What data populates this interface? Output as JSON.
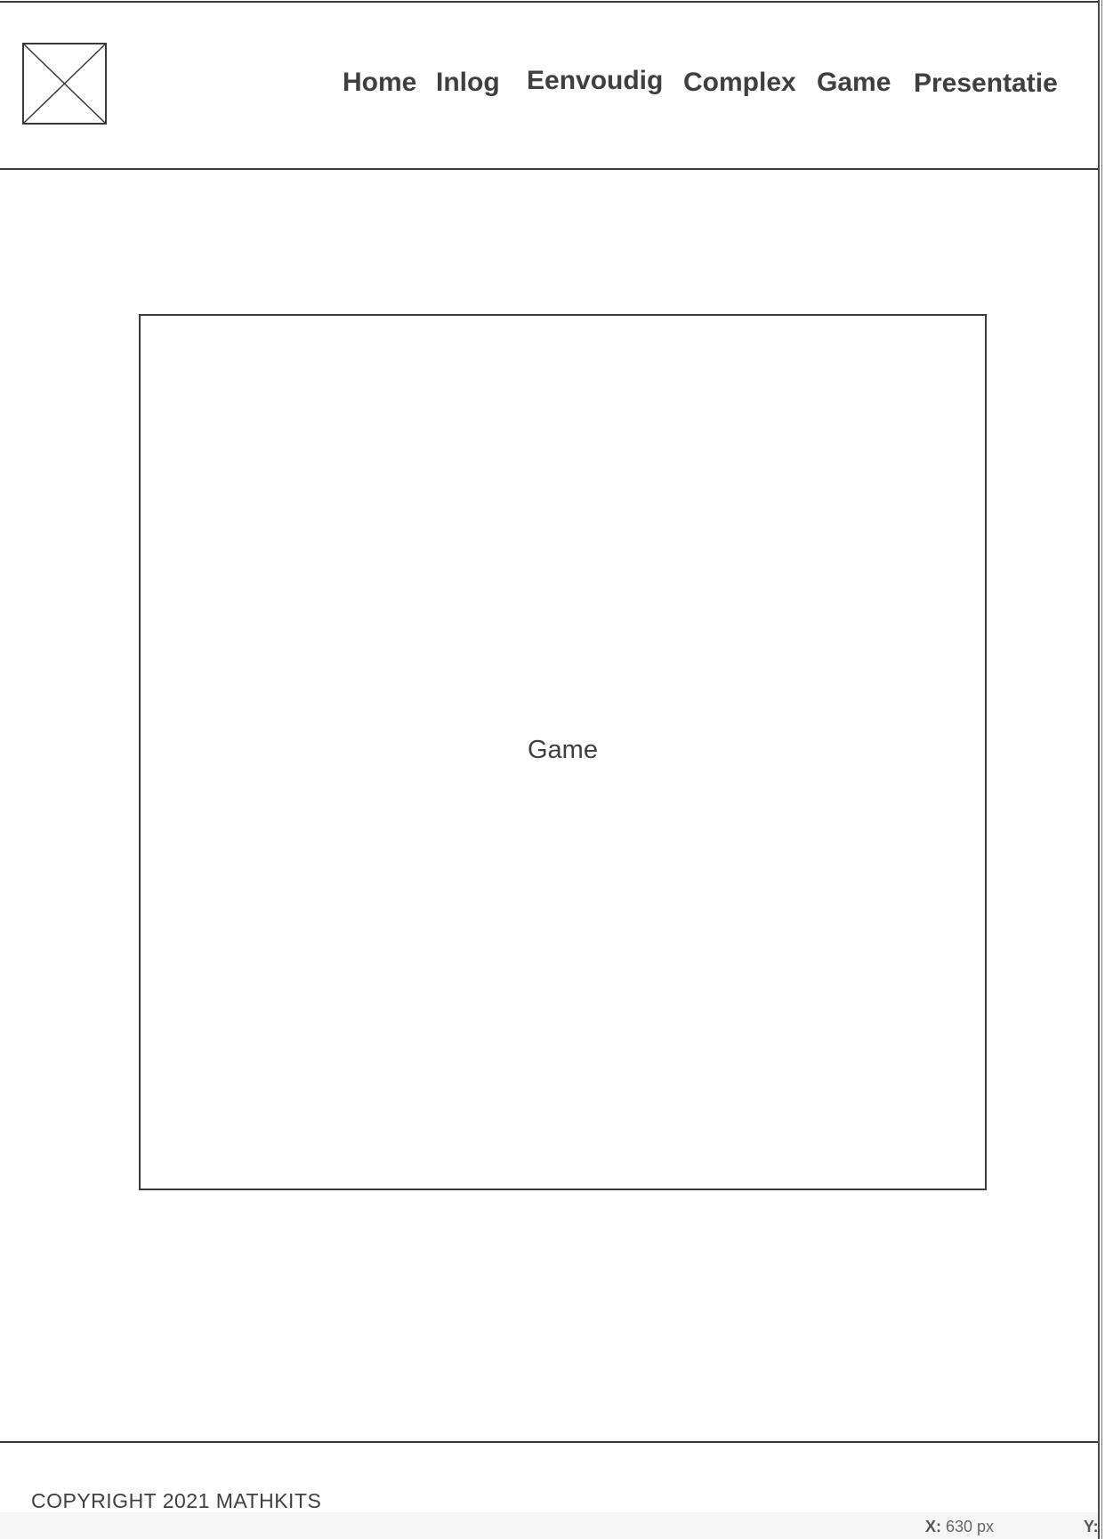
{
  "nav": {
    "items": [
      {
        "label": "Home"
      },
      {
        "label": "Inlog"
      },
      {
        "label": "Eenvoudig"
      },
      {
        "label": "Complex"
      },
      {
        "label": "Game"
      },
      {
        "label": "Presentatie"
      }
    ]
  },
  "logo": {
    "icon": "image-placeholder-icon"
  },
  "main": {
    "game_label": "Game"
  },
  "footer": {
    "copyright": "COPYRIGHT 2021 MATHKITS"
  },
  "coordinates": {
    "x_label": "X:",
    "x_value": "630 px",
    "y_label": "Y:"
  },
  "colors": {
    "text": "#3f3f3f",
    "border": "#3a3a3a",
    "background": "#ffffff"
  }
}
